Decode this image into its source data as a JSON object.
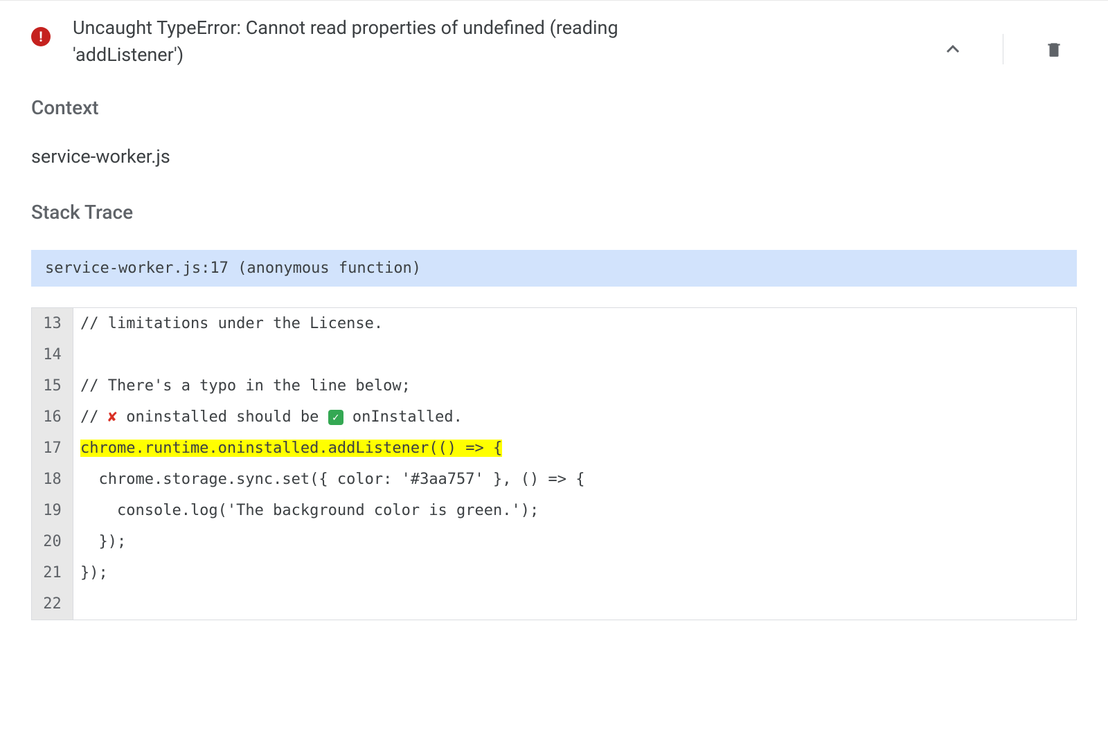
{
  "error": {
    "title": "Uncaught TypeError: Cannot read properties of undefined (reading 'addListener')"
  },
  "context": {
    "heading": "Context",
    "value": "service-worker.js"
  },
  "stacktrace": {
    "heading": "Stack Trace",
    "frame": "service-worker.js:17 (anonymous function)"
  },
  "code": {
    "lines": [
      {
        "num": "13",
        "text": "// limitations under the License.",
        "hl": false
      },
      {
        "num": "14",
        "text": "",
        "hl": false
      },
      {
        "num": "15",
        "text": "// There's a typo in the line below;",
        "hl": false
      },
      {
        "num": "16",
        "pre": "// ",
        "x": "✘",
        "mid": " oninstalled should be ",
        "check": "✓",
        "post": " onInstalled.",
        "hl": false,
        "emoji": true
      },
      {
        "num": "17",
        "text": "chrome.runtime.oninstalled.addListener(() => {",
        "hl": true
      },
      {
        "num": "18",
        "text": "  chrome.storage.sync.set({ color: '#3aa757' }, () => {",
        "hl": false
      },
      {
        "num": "19",
        "text": "    console.log('The background color is green.');",
        "hl": false
      },
      {
        "num": "20",
        "text": "  });",
        "hl": false
      },
      {
        "num": "21",
        "text": "});",
        "hl": false
      },
      {
        "num": "22",
        "text": "",
        "hl": false
      }
    ]
  }
}
